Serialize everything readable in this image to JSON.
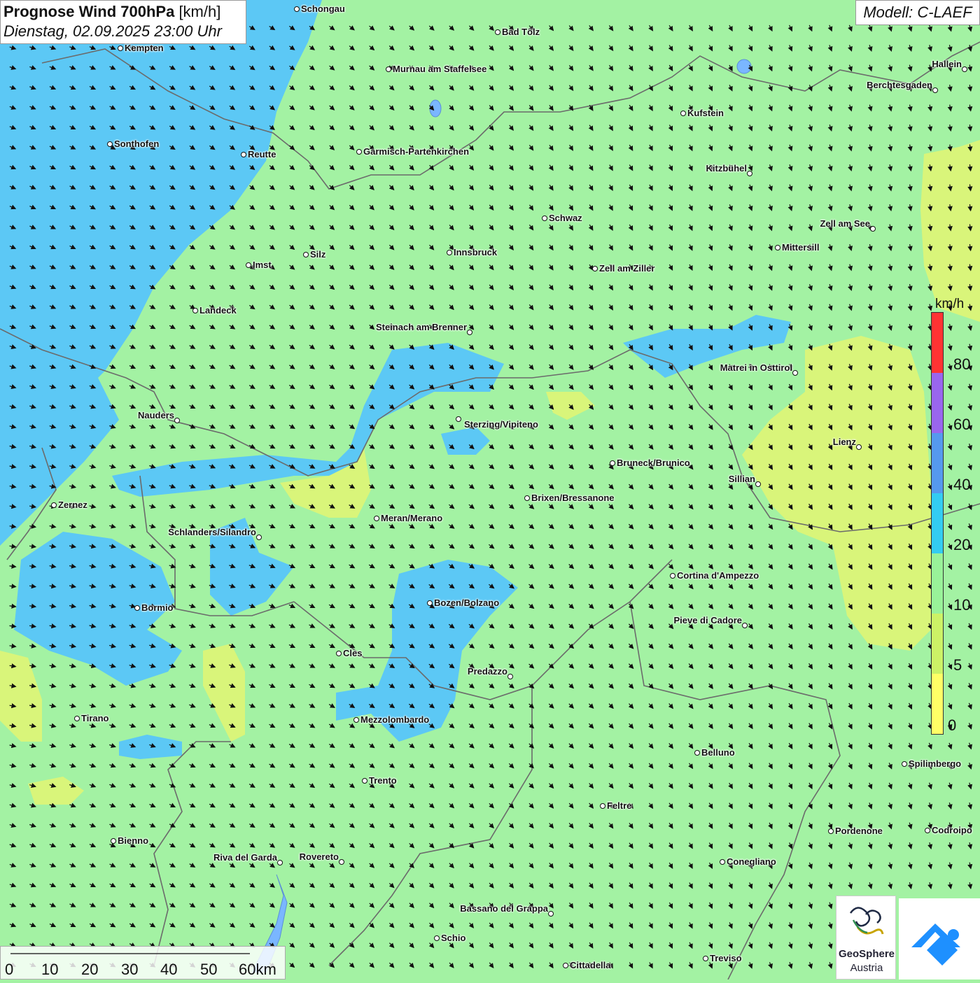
{
  "header": {
    "title_bold": "Prognose Wind 700hPa",
    "title_unit": "[km/h]",
    "datetime": "Dienstag, 02.09.2025 23:00 Uhr",
    "model": "Modell: C-LAEF"
  },
  "legend": {
    "unit": "km/h",
    "labels": [
      "0",
      "5",
      "10",
      "20",
      "40",
      "60",
      "80"
    ],
    "colors": [
      "#ffff66",
      "#ccf266",
      "#99f299",
      "#33ccf2",
      "#5599ee",
      "#9966ee",
      "#ff3333"
    ]
  },
  "scalebar": {
    "labels": [
      "0",
      "10",
      "20",
      "30",
      "40",
      "50",
      "60km"
    ]
  },
  "logos": {
    "geosphere_line1": "GeoSphere",
    "geosphere_line2": "Austria",
    "geosphere_icon": "geosphere-logo-icon",
    "app_icon": "weather-app-logo-icon"
  },
  "colors": {
    "wind_10_20": "#a3f2a3",
    "wind_20_40": "#5cc8f5",
    "wind_5_10": "#d9f57a",
    "border": "#6b6b6b",
    "lake": "#7ab6ff"
  },
  "places": [
    {
      "name": "Schongau"
    },
    {
      "name": "Bad Tölz"
    },
    {
      "name": "Kempten"
    },
    {
      "name": "Murnau am Staffelsee"
    },
    {
      "name": "Hallein"
    },
    {
      "name": "Berchtesgaden"
    },
    {
      "name": "Kufstein"
    },
    {
      "name": "Sonthofen"
    },
    {
      "name": "Reutte"
    },
    {
      "name": "Garmisch-Partenkirchen"
    },
    {
      "name": "Kitzbühel"
    },
    {
      "name": "Schwaz"
    },
    {
      "name": "Zell am See"
    },
    {
      "name": "Mittersill"
    },
    {
      "name": "Innsbruck"
    },
    {
      "name": "Silz"
    },
    {
      "name": "Imst"
    },
    {
      "name": "Zell am Ziller"
    },
    {
      "name": "Landeck"
    },
    {
      "name": "Steinach am Brenner"
    },
    {
      "name": "Matrei in Osttirol"
    },
    {
      "name": "Nauders"
    },
    {
      "name": "Sterzing/Vipiteno"
    },
    {
      "name": "Lienz"
    },
    {
      "name": "Bruneck/Brunico"
    },
    {
      "name": "Sillian"
    },
    {
      "name": "Zernez"
    },
    {
      "name": "Brixen/Bressanone"
    },
    {
      "name": "Meran/Merano"
    },
    {
      "name": "Schlanders/Silandro"
    },
    {
      "name": "Cortina d'Ampezzo"
    },
    {
      "name": "Bozen/Bolzano"
    },
    {
      "name": "Bormio"
    },
    {
      "name": "Pieve di Cadore"
    },
    {
      "name": "Cles"
    },
    {
      "name": "Predazzo"
    },
    {
      "name": "Tirano"
    },
    {
      "name": "Mezzolombardo"
    },
    {
      "name": "Belluno"
    },
    {
      "name": "Spilimbergo"
    },
    {
      "name": "Trento"
    },
    {
      "name": "Feltre"
    },
    {
      "name": "Pordenone"
    },
    {
      "name": "Codroipo"
    },
    {
      "name": "Bienno"
    },
    {
      "name": "Riva del Garda"
    },
    {
      "name": "Rovereto"
    },
    {
      "name": "Conegliano"
    },
    {
      "name": "Bassano del Grappa"
    },
    {
      "name": "Schio"
    },
    {
      "name": "Treviso"
    },
    {
      "name": "Cittadella"
    }
  ]
}
